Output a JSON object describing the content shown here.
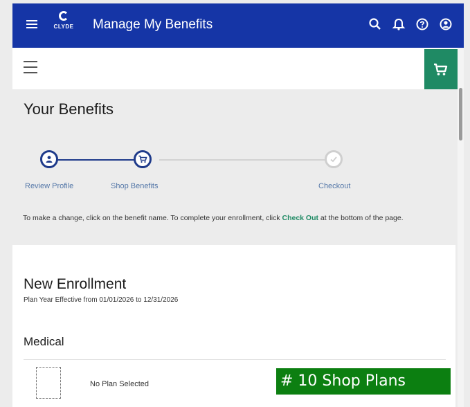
{
  "header": {
    "logo_text": "CLYDE",
    "title": "Manage My Benefits",
    "icons": [
      "search-icon",
      "bell-icon",
      "help-icon",
      "user-icon"
    ]
  },
  "toolbar": {
    "menu_icon": "hamburger-icon",
    "cart_icon": "cart-icon",
    "cart_color": "#1f8a64"
  },
  "benefits": {
    "title": "Your Benefits",
    "steps": [
      {
        "label": "Review Profile",
        "icon": "user-icon",
        "state": "complete"
      },
      {
        "label": "Shop Benefits",
        "icon": "cart-icon",
        "state": "current"
      },
      {
        "label": "Checkout",
        "icon": "check-icon",
        "state": "upcoming"
      }
    ],
    "instructions_before": "To make a change, click on the benefit name. To complete your enrollment, click ",
    "instructions_link": "Check Out",
    "instructions_after": " at the bottom of the page."
  },
  "enrollment": {
    "title": "New Enrollment",
    "plan_year": "Plan Year Effective from 01/01/2026 to 12/31/2026",
    "section": "Medical",
    "plan_status": "No Plan Selected"
  },
  "overlay": {
    "caption": "# 10 Shop Plans"
  },
  "colors": {
    "header_bg": "#1535a6",
    "accent_green": "#1f8a64",
    "step_active": "#1e3a8a",
    "step_label": "#5477a8"
  }
}
